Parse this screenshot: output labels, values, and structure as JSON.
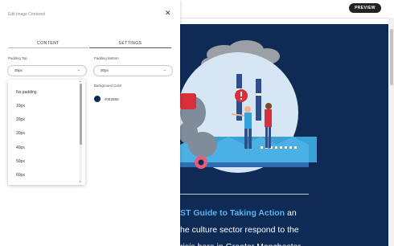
{
  "topbar": {
    "preview_label": "PREVIEW"
  },
  "panel": {
    "title": "Edit Image Centered",
    "tabs": [
      {
        "label": "CONTENT"
      },
      {
        "label": "SETTINGS"
      }
    ],
    "padding_top": {
      "label": "Padding Top",
      "value": "30px"
    },
    "padding_bottom": {
      "label": "Padding Bottom",
      "value": "30px"
    },
    "background_color": {
      "label": "Background Color",
      "value": "#0E2B56"
    },
    "dropdown_options": [
      "No padding",
      "10px",
      "20px",
      "30px",
      "40px",
      "50px",
      "60px"
    ]
  },
  "preview": {
    "text_highlight": "ST Guide to Taking Action",
    "text_after": " an",
    "line2": "he culture sector respond to the",
    "line3": "risis here in Greater Manchester"
  },
  "colors": {
    "navy": "#0e2b56",
    "highlight": "#5ab4f0"
  }
}
